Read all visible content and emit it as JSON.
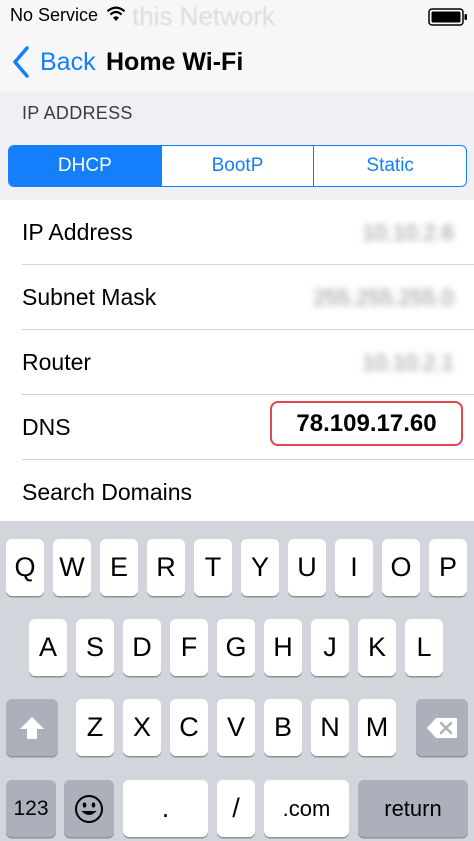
{
  "status_bar": {
    "carrier": "No Service",
    "ghost_title": "this Network",
    "wifi_icon": "wifi-icon",
    "battery_icon": "battery-icon"
  },
  "nav": {
    "back_label": "Back",
    "title": "Home Wi-Fi"
  },
  "section_header": "IP ADDRESS",
  "segments": {
    "items": [
      "DHCP",
      "BootP",
      "Static"
    ],
    "selected": "DHCP"
  },
  "rows": {
    "ip_address": {
      "label": "IP Address",
      "value": "10.10.2.6"
    },
    "subnet_mask": {
      "label": "Subnet Mask",
      "value": "255.255.255.0"
    },
    "router": {
      "label": "Router",
      "value": "10.10.2.1"
    },
    "dns": {
      "label": "DNS",
      "value": "78.109.17.60"
    },
    "search_domains": {
      "label": "Search Domains"
    }
  },
  "keyboard": {
    "row1": [
      "Q",
      "W",
      "E",
      "R",
      "T",
      "Y",
      "U",
      "I",
      "O",
      "P"
    ],
    "row2": [
      "A",
      "S",
      "D",
      "F",
      "G",
      "H",
      "J",
      "K",
      "L"
    ],
    "row3": [
      "Z",
      "X",
      "C",
      "V",
      "B",
      "N",
      "M"
    ],
    "row4": {
      "numbers": "123",
      "period": ".",
      "slash": "/",
      "dotcom": ".com",
      "return": "return"
    },
    "shift_icon": "shift-icon",
    "delete_icon": "delete-icon",
    "emoji_icon": "emoji-icon",
    "accent_color": "#157efb",
    "alert_color": "#e0474e"
  }
}
